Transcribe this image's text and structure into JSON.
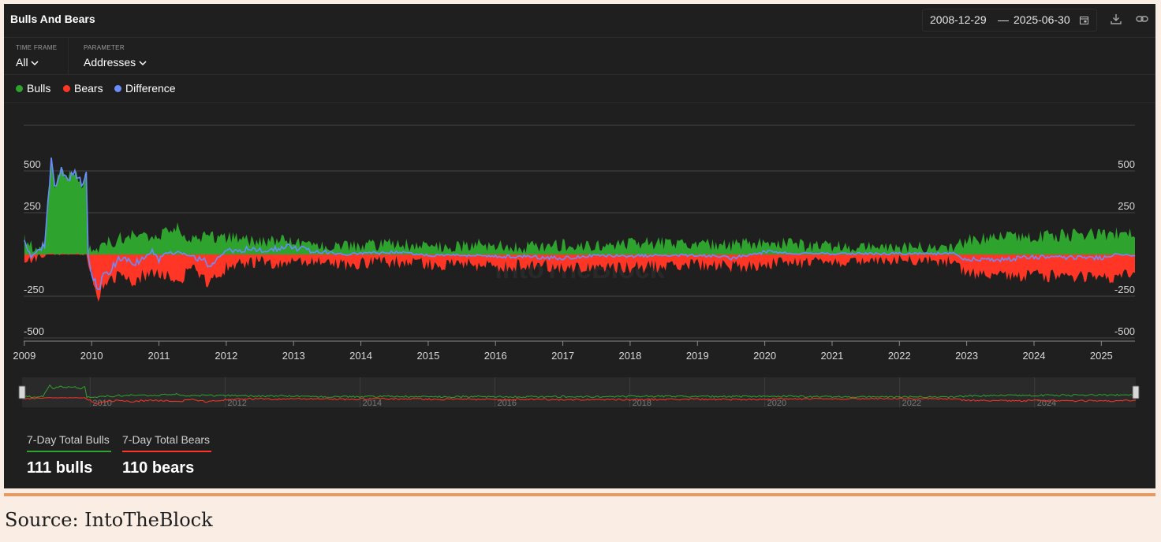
{
  "header": {
    "title": "Bulls And Bears",
    "date_start": "2008-12-29",
    "date_sep": "—",
    "date_end": "2025-06-30"
  },
  "filters": {
    "timeframe_label": "TIME FRAME",
    "timeframe_value": "All",
    "parameter_label": "PARAMETER",
    "parameter_value": "Addresses"
  },
  "icons": {
    "calendar": "calendar-icon",
    "download": "download-icon",
    "link": "link-icon",
    "chevron": "chevron-down-icon"
  },
  "stats": {
    "bulls_label": "7-Day Total Bulls",
    "bulls_value": "111 bulls",
    "bears_label": "7-Day Total Bears",
    "bears_value": "110 bears"
  },
  "source": "Source: IntoTheBlock",
  "chart_data": {
    "type": "area",
    "watermark": "IntoTheBlock",
    "x_labels": [
      "2009",
      "2010",
      "2011",
      "2012",
      "2013",
      "2014",
      "2015",
      "2016",
      "2017",
      "2018",
      "2019",
      "2020",
      "2021",
      "2022",
      "2023",
      "2024",
      "2025"
    ],
    "y_ticks": [
      500,
      250,
      -250,
      -500
    ],
    "xlim": [
      2008.99,
      2025.5
    ],
    "ylim": [
      -500,
      500
    ],
    "navigator_labels": [
      "2010",
      "2012",
      "2014",
      "2016",
      "2018",
      "2020",
      "2022",
      "2024"
    ],
    "colors": {
      "bulls": "#2ea32e",
      "bears": "#ff3525",
      "difference": "#6b8cff"
    },
    "series": [
      {
        "name": "Bulls",
        "x": [
          2009.0,
          2009.1,
          2009.2,
          2009.3,
          2009.35,
          2009.4,
          2009.45,
          2009.55,
          2009.65,
          2009.75,
          2009.85,
          2009.92,
          2009.95,
          2010.0,
          2010.1,
          2010.2,
          2010.3,
          2010.4,
          2010.5,
          2010.6,
          2010.75,
          2010.9,
          2011.0,
          2011.1,
          2011.3,
          2011.5,
          2011.75,
          2012.0,
          2012.25,
          2012.5,
          2012.75,
          2013.0,
          2013.25,
          2013.5,
          2013.75,
          2014.0,
          2014.5,
          2015.0,
          2015.5,
          2016.0,
          2016.5,
          2017.0,
          2017.5,
          2018.0,
          2018.5,
          2019.0,
          2019.5,
          2020.0,
          2020.5,
          2021.0,
          2021.5,
          2022.0,
          2022.5,
          2022.8,
          2022.95,
          2023.1,
          2023.5,
          2024.0,
          2024.5,
          2025.0,
          2025.2,
          2025.4,
          2025.5
        ],
        "y": [
          90,
          50,
          40,
          60,
          300,
          560,
          400,
          500,
          450,
          500,
          420,
          480,
          40,
          20,
          25,
          80,
          60,
          100,
          90,
          110,
          100,
          120,
          90,
          140,
          160,
          80,
          110,
          100,
          90,
          70,
          80,
          90,
          60,
          50,
          60,
          55,
          60,
          50,
          55,
          60,
          45,
          55,
          60,
          70,
          65,
          60,
          55,
          75,
          55,
          50,
          45,
          40,
          45,
          50,
          70,
          90,
          100,
          110,
          115,
          120,
          130,
          125,
          100
        ]
      },
      {
        "name": "Bears",
        "x": [
          2009.0,
          2009.1,
          2009.2,
          2009.3,
          2009.35,
          2009.4,
          2009.45,
          2009.55,
          2009.65,
          2009.75,
          2009.85,
          2009.92,
          2009.95,
          2010.0,
          2010.1,
          2010.2,
          2010.3,
          2010.4,
          2010.5,
          2010.6,
          2010.75,
          2010.9,
          2011.0,
          2011.1,
          2011.3,
          2011.5,
          2011.75,
          2012.0,
          2012.25,
          2012.5,
          2012.75,
          2013.0,
          2013.25,
          2013.5,
          2013.75,
          2014.0,
          2014.5,
          2015.0,
          2015.5,
          2016.0,
          2016.5,
          2017.0,
          2017.5,
          2018.0,
          2018.5,
          2019.0,
          2019.5,
          2020.0,
          2020.5,
          2021.0,
          2021.5,
          2022.0,
          2022.5,
          2022.8,
          2022.95,
          2023.1,
          2023.5,
          2024.0,
          2024.5,
          2025.0,
          2025.2,
          2025.4,
          2025.5
        ],
        "y": [
          -30,
          -60,
          -20,
          -10,
          0,
          0,
          0,
          0,
          0,
          0,
          0,
          0,
          -60,
          -120,
          -250,
          -180,
          -150,
          -130,
          -110,
          -160,
          -130,
          -100,
          -120,
          -130,
          -150,
          -90,
          -170,
          -80,
          -60,
          -40,
          -50,
          -45,
          -40,
          -35,
          -60,
          -50,
          -45,
          -55,
          -60,
          -70,
          -60,
          -75,
          -65,
          -80,
          -70,
          -65,
          -75,
          -60,
          -50,
          -45,
          -40,
          -35,
          -40,
          -45,
          -90,
          -120,
          -130,
          -125,
          -135,
          -140,
          -130,
          -125,
          -110
        ]
      },
      {
        "name": "Difference",
        "x": [
          2009.0,
          2009.1,
          2009.2,
          2009.3,
          2009.35,
          2009.4,
          2009.45,
          2009.55,
          2009.65,
          2009.75,
          2009.85,
          2009.92,
          2009.95,
          2010.0,
          2010.1,
          2010.2,
          2010.3,
          2010.4,
          2010.5,
          2010.6,
          2010.75,
          2010.9,
          2011.0,
          2011.1,
          2011.3,
          2011.5,
          2011.75,
          2012.0,
          2012.25,
          2012.5,
          2012.75,
          2013.0,
          2013.25,
          2013.5,
          2013.75,
          2014.0,
          2014.5,
          2015.0,
          2015.5,
          2016.0,
          2016.5,
          2017.0,
          2017.5,
          2018.0,
          2018.5,
          2019.0,
          2019.5,
          2020.0,
          2020.5,
          2021.0,
          2021.5,
          2022.0,
          2022.5,
          2022.8,
          2022.95,
          2023.1,
          2023.5,
          2024.0,
          2024.5,
          2025.0,
          2025.2,
          2025.4,
          2025.5
        ],
        "y": [
          60,
          -10,
          20,
          50,
          300,
          560,
          400,
          500,
          450,
          500,
          420,
          480,
          -20,
          -100,
          -225,
          -100,
          -90,
          -30,
          -20,
          -50,
          -30,
          20,
          -30,
          10,
          10,
          -10,
          -60,
          20,
          30,
          30,
          30,
          45,
          20,
          15,
          0,
          5,
          15,
          -5,
          -5,
          -10,
          -15,
          -20,
          -5,
          -10,
          -5,
          -5,
          -20,
          15,
          5,
          5,
          5,
          5,
          5,
          5,
          -20,
          -30,
          -30,
          -15,
          -20,
          -20,
          0,
          0,
          -10
        ]
      }
    ]
  }
}
